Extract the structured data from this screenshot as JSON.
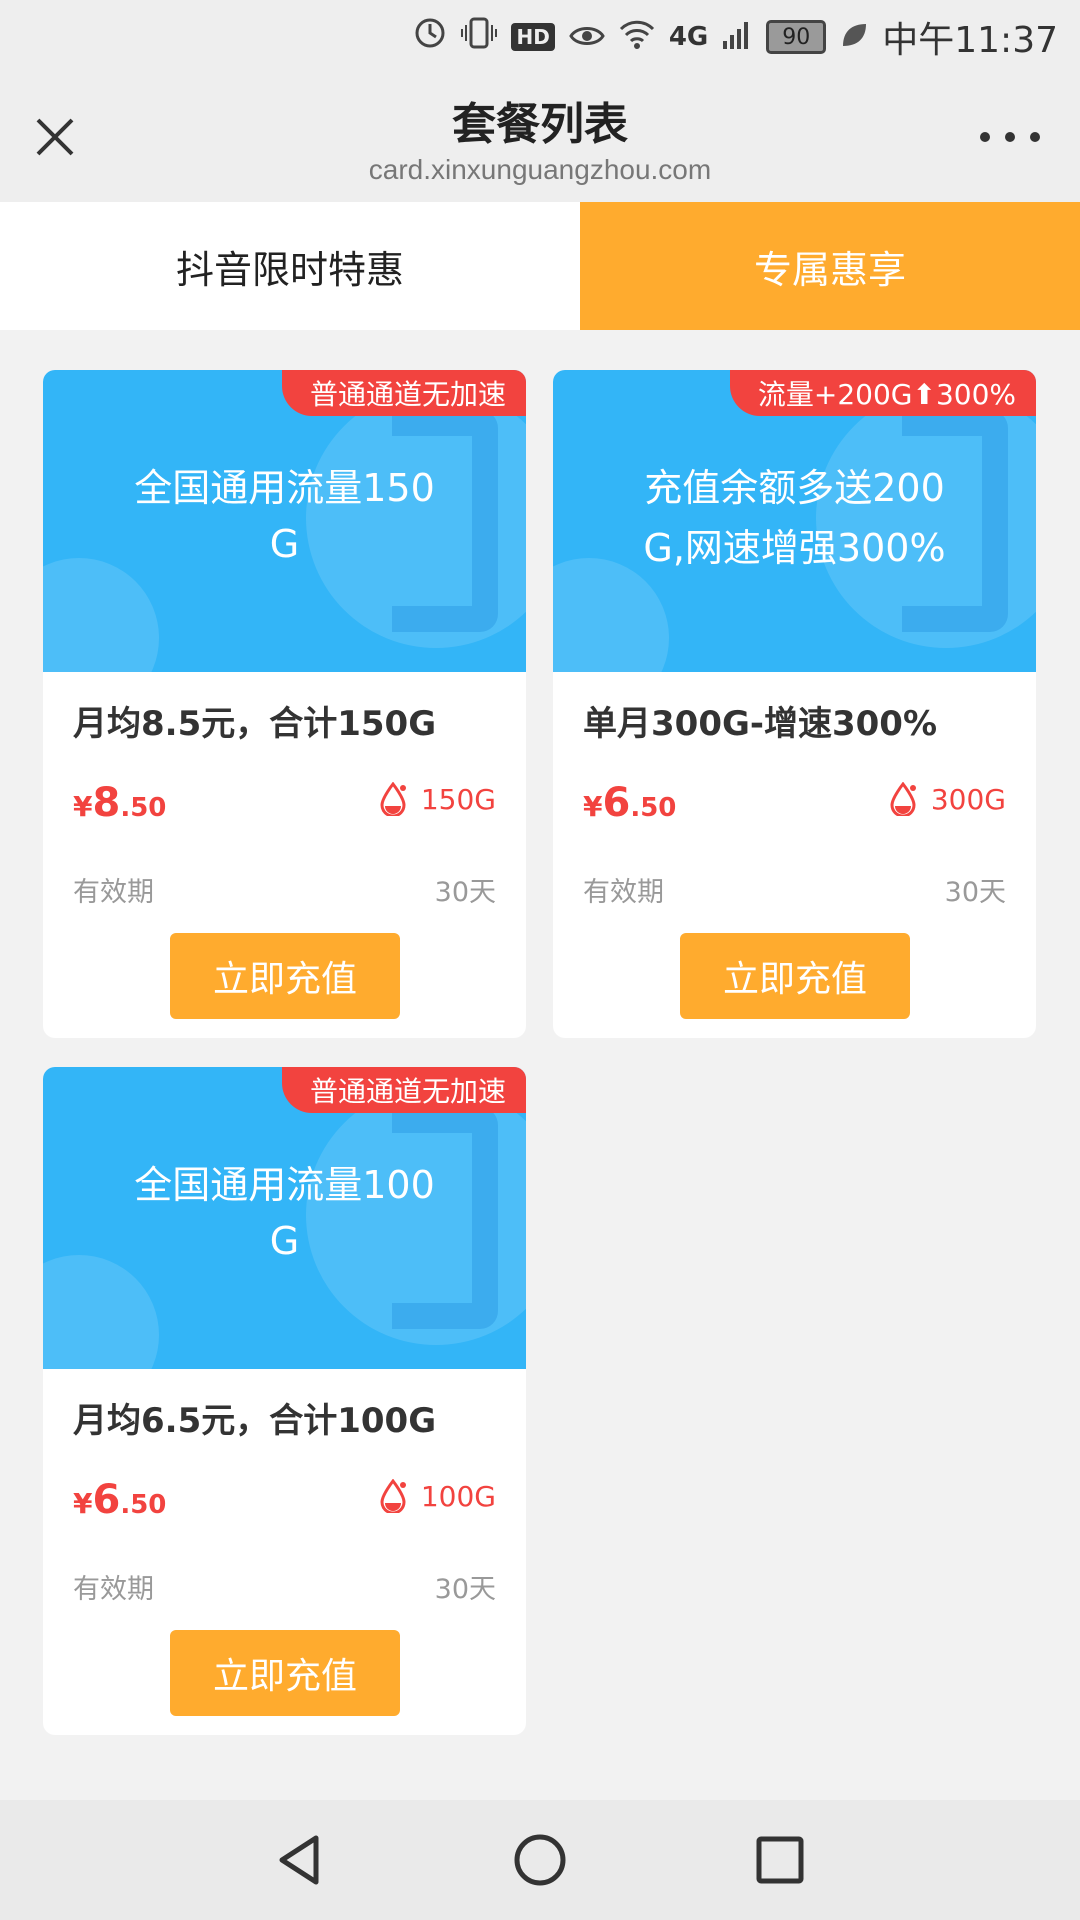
{
  "status_bar": {
    "network_label": "4G",
    "hd_label": "HD",
    "battery": "90",
    "time": "中午11:37"
  },
  "titlebar": {
    "title": "套餐列表",
    "subtitle": "card.xinxunguangzhou.com"
  },
  "tabs": [
    {
      "label": "抖音限时特惠",
      "active": false
    },
    {
      "label": "专属惠享",
      "active": true
    }
  ],
  "cards": [
    {
      "tag": "普通通道无加速",
      "banner": "全国通用流量150G",
      "name": "月均8.5元，合计150G",
      "currency": "¥",
      "price_int": "8",
      "price_dec": ".50",
      "data": "150G",
      "validity_label": "有效期",
      "validity": "30天",
      "button": "立即充值"
    },
    {
      "tag": "流量+200G⬆300%",
      "banner": "充值余额多送200G,网速增强300%",
      "name": "单月300G-增速300%",
      "currency": "¥",
      "price_int": "6",
      "price_dec": ".50",
      "data": "300G",
      "validity_label": "有效期",
      "validity": "30天",
      "button": "立即充值"
    },
    {
      "tag": "普通通道无加速",
      "banner": "全国通用流量100G",
      "name": "月均6.5元，合计100G",
      "currency": "¥",
      "price_int": "6",
      "price_dec": ".50",
      "data": "100G",
      "validity_label": "有效期",
      "validity": "30天",
      "button": "立即充值"
    }
  ],
  "colors": {
    "accent": "#ffab2e",
    "banner": "#33b5f7",
    "tag": "#f2433f",
    "price": "#f2433f"
  }
}
